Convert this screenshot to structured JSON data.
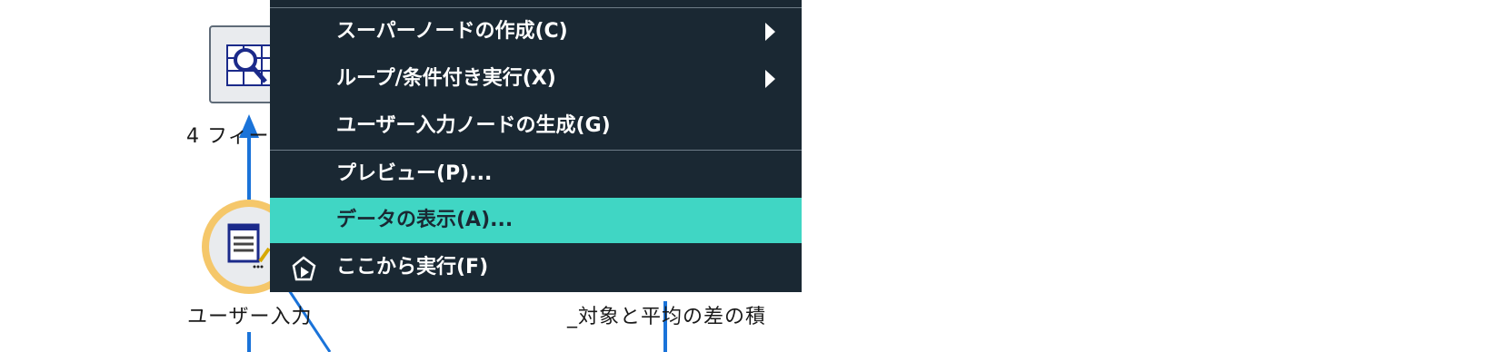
{
  "canvas": {
    "nodes": [
      {
        "label": "4 フィー"
      },
      {
        "label": "ユーザー入力"
      },
      {
        "label": "_対象と平均の差の積"
      }
    ]
  },
  "context_menu": {
    "items": [
      {
        "label": "スーパーノードの作成(C)",
        "submenu": true
      },
      {
        "label": "ループ/条件付き実行(X)",
        "submenu": true
      },
      {
        "label": "ユーザー入力ノードの生成(G)"
      },
      {
        "label": "プレビュー(P)..."
      },
      {
        "label": "データの表示(A)...",
        "highlighted": true
      },
      {
        "label": "ここから実行(F)",
        "icon": "run-from-here-icon"
      }
    ]
  },
  "colors": {
    "menu_background": "#1a2833",
    "menu_highlight": "#40d6c4",
    "connector": "#1a73d9",
    "selected_node_ring": "#f5c76a"
  }
}
